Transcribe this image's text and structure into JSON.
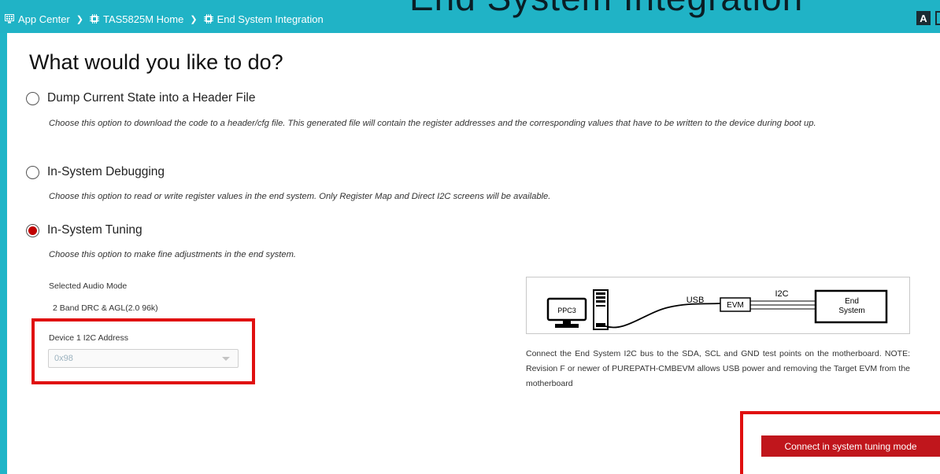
{
  "breadcrumb": [
    {
      "label": "App Center",
      "icon": "app-grid-icon"
    },
    {
      "label": "TAS5825M Home",
      "icon": "chip-icon"
    },
    {
      "label": "End System Integration",
      "icon": "chip-icon"
    }
  ],
  "header": {
    "decorative_title": "End System Integration",
    "avatar_letter": "A",
    "accent_color": "#20b3c6"
  },
  "page": {
    "heading": "What would you like to do?"
  },
  "options": [
    {
      "label": "Dump Current State into a Header File",
      "description": "Choose this option to download the code to a header/cfg file. This generated file will contain the register addresses and the corresponding values that have to be written to the device during boot up.",
      "selected": false
    },
    {
      "label": "In-System Debugging",
      "description": "Choose this option to read or write register values in the end system. Only Register Map and Direct I2C screens will be available.",
      "selected": false
    },
    {
      "label": "In-System Tuning",
      "description": "Choose this option to make fine adjustments in the end system.",
      "selected": true
    }
  ],
  "tuning": {
    "audio_mode_label": "Selected Audio Mode",
    "audio_mode_value": "2 Band DRC & AGL(2.0 96k)",
    "device_address_label": "Device 1 I2C Address",
    "device_address_value": "0x98"
  },
  "diagram": {
    "pc_label": "PPC3",
    "usb_label": "USB",
    "evm_label": "EVM",
    "i2c_label": "I2C",
    "end_system_line1": "End",
    "end_system_line2": "System",
    "caption": "Connect the End System I2C bus to the SDA, SCL and GND test points on the motherboard. NOTE: Revision F or newer of PUREPATH-CMBEVM allows USB power and removing the Target EVM from the motherboard"
  },
  "actions": {
    "connect_label": "Connect in system tuning mode",
    "button_color": "#c0161c"
  }
}
